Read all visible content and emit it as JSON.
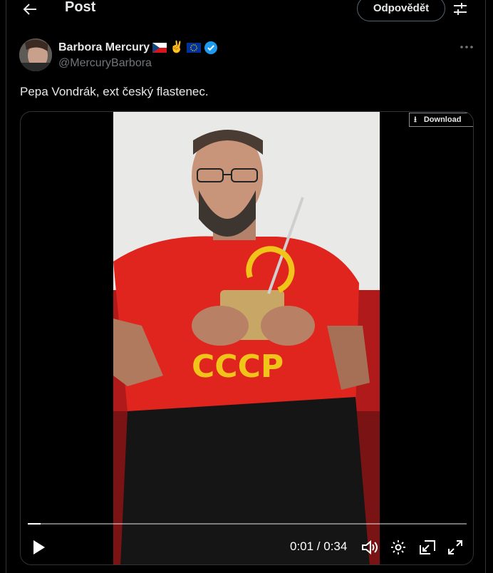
{
  "header": {
    "title": "Post",
    "reply_label": "Odpovědět"
  },
  "author": {
    "name": "Barbora Mercury",
    "handle": "@MercuryBarbora",
    "badges": [
      "czech-flag",
      "victory-hand-emoji",
      "eu-flag",
      "verified-badge"
    ]
  },
  "tweet": {
    "text": "Pepa Vondrák, ext český flastenec."
  },
  "media": {
    "download_label": "Download",
    "time": "0:01 / 0:34",
    "progress": 0.03,
    "shirt_text": "CCCP"
  },
  "icons": {
    "back": "arrow-left-icon",
    "filter": "sliders-icon",
    "more": "more-icon",
    "play": "play-icon",
    "volume": "volume-icon",
    "settings": "gear-icon",
    "pip": "picture-in-picture-icon",
    "fullscreen": "fullscreen-icon"
  },
  "colors": {
    "accent_blue": "#1d9bf0",
    "bg": "#000000",
    "text": "#e7e9ea",
    "muted": "#71767b"
  }
}
